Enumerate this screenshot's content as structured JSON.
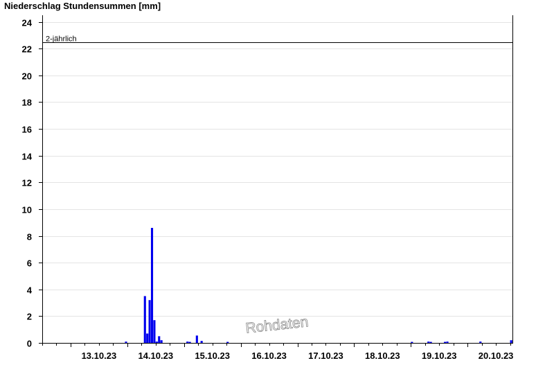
{
  "chart_data": {
    "type": "bar",
    "title": "Niederschlag Stundensummen [mm]",
    "ylim": [
      0,
      24.5
    ],
    "y_ticks": [
      0,
      2,
      4,
      6,
      8,
      10,
      12,
      14,
      16,
      18,
      20,
      22,
      24
    ],
    "x_range": [
      "2023-10-12T12:00",
      "2023-10-20T19:00"
    ],
    "x_tick_labels": [
      "13.10.23",
      "14.10.23",
      "15.10.23",
      "16.10.23",
      "17.10.23",
      "18.10.23",
      "19.10.23",
      "20.10.23"
    ],
    "grid": true,
    "bar_color": "#0000ee",
    "reference_line": {
      "label": "2-jährlich",
      "value": 22.5
    },
    "watermark": "Rohdaten",
    "series": [
      {
        "points": [
          {
            "t": "2023-10-13T23:00",
            "v": 0.1
          },
          {
            "t": "2023-10-14T07:00",
            "v": 3.5
          },
          {
            "t": "2023-10-14T08:00",
            "v": 0.7
          },
          {
            "t": "2023-10-14T09:00",
            "v": 3.2
          },
          {
            "t": "2023-10-14T10:00",
            "v": 8.6
          },
          {
            "t": "2023-10-14T11:00",
            "v": 1.7
          },
          {
            "t": "2023-10-14T12:00",
            "v": 0.1
          },
          {
            "t": "2023-10-14T13:00",
            "v": 0.5
          },
          {
            "t": "2023-10-14T14:00",
            "v": 0.2
          },
          {
            "t": "2023-10-15T01:00",
            "v": 0.1
          },
          {
            "t": "2023-10-15T02:00",
            "v": 0.05
          },
          {
            "t": "2023-10-15T05:00",
            "v": 0.55
          },
          {
            "t": "2023-10-15T07:00",
            "v": 0.15
          },
          {
            "t": "2023-10-15T18:00",
            "v": 0.05
          },
          {
            "t": "2023-10-19T00:00",
            "v": 0.05
          },
          {
            "t": "2023-10-19T07:00",
            "v": 0.1
          },
          {
            "t": "2023-10-19T08:00",
            "v": 0.05
          },
          {
            "t": "2023-10-19T14:00",
            "v": 0.05
          },
          {
            "t": "2023-10-19T15:00",
            "v": 0.1
          },
          {
            "t": "2023-10-20T05:00",
            "v": 0.1
          },
          {
            "t": "2023-10-20T18:00",
            "v": 0.2
          }
        ]
      }
    ]
  }
}
